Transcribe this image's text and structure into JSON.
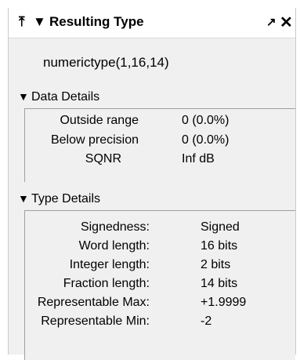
{
  "panel": {
    "title": "Resulting Type",
    "pin_icon_glyph": "⤒",
    "collapse_icon_glyph": "▼",
    "undock_icon_glyph": "↗",
    "close_icon_glyph": "✕",
    "type_string": "numerictype(1,16,14)"
  },
  "data_details": {
    "header": "Data Details",
    "rows": [
      {
        "label": "Outside range",
        "value": "0 (0.0%)"
      },
      {
        "label": "Below precision",
        "value": "0 (0.0%)"
      },
      {
        "label": "SQNR",
        "value": "Inf dB"
      }
    ]
  },
  "type_details": {
    "header": "Type Details",
    "rows": [
      {
        "label": "Signedness:",
        "value": "Signed"
      },
      {
        "label": "Word length:",
        "value": "16 bits"
      },
      {
        "label": "Integer length:",
        "value": "2 bits"
      },
      {
        "label": "Fraction length:",
        "value": "14 bits"
      },
      {
        "label": "Representable Max:",
        "value": "+1.9999"
      },
      {
        "label": "Representable Min:",
        "value": "-2"
      }
    ]
  }
}
